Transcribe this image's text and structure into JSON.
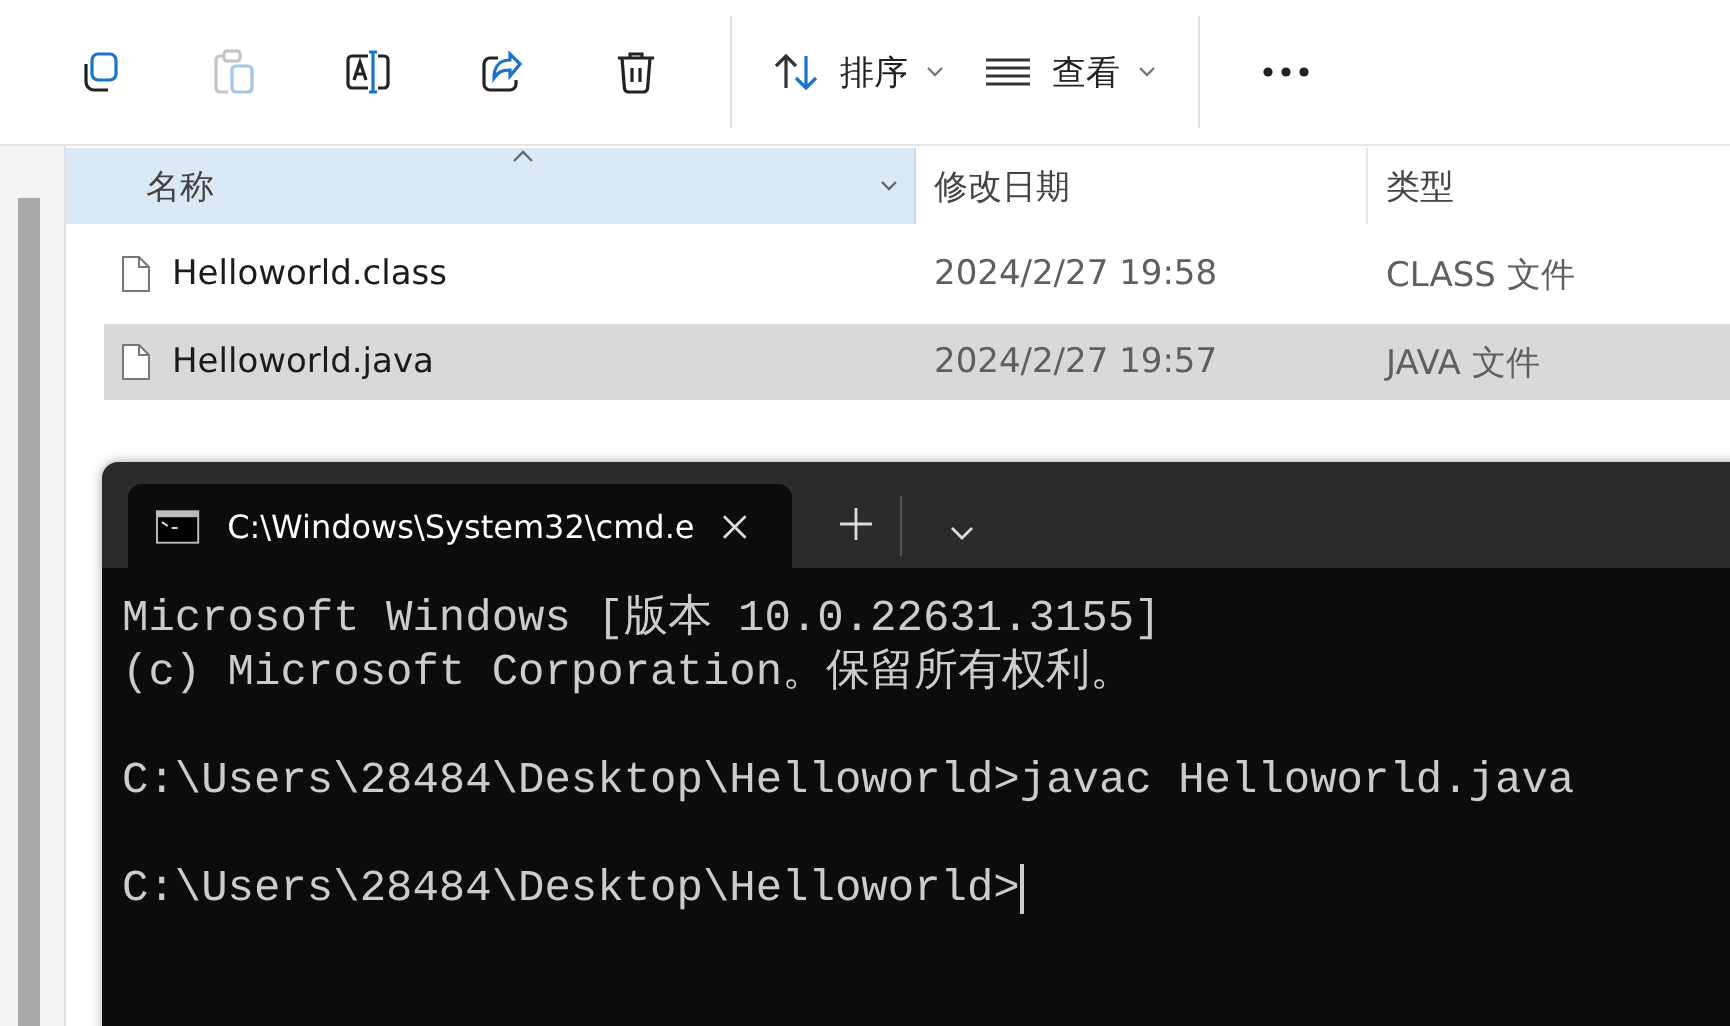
{
  "toolbar": {
    "actions": [
      {
        "kind": "copy",
        "disabled": false
      },
      {
        "kind": "paste",
        "disabled": true
      },
      {
        "kind": "rename",
        "disabled": false
      },
      {
        "kind": "share",
        "disabled": false
      },
      {
        "kind": "delete",
        "disabled": false
      }
    ],
    "menus": [
      {
        "kind": "sort",
        "label": "排序"
      },
      {
        "kind": "view",
        "label": "查看"
      }
    ]
  },
  "table": {
    "columns": [
      {
        "label": "名称",
        "selected": true,
        "sorted": true
      },
      {
        "label": "修改日期",
        "selected": false,
        "sorted": false
      },
      {
        "label": "类型",
        "selected": false,
        "sorted": false
      }
    ],
    "rows": [
      {
        "name": "Helloworld.class",
        "date": "2024/2/27 19:58",
        "type": "CLASS 文件",
        "selected": false
      },
      {
        "name": "Helloworld.java",
        "date": "2024/2/27 19:57",
        "type": "JAVA 文件",
        "selected": true
      }
    ]
  },
  "terminal": {
    "tab_title": "C:\\Windows\\System32\\cmd.e",
    "paragraphs": [
      [
        "Microsoft Windows [版本 10.0.22631.3155]",
        "(c) Microsoft Corporation。保留所有权利。"
      ],
      [
        "C:\\Users\\28484\\Desktop\\Helloworld>javac Helloworld.java"
      ],
      [
        "C:\\Users\\28484\\Desktop\\Helloworld>"
      ]
    ]
  }
}
